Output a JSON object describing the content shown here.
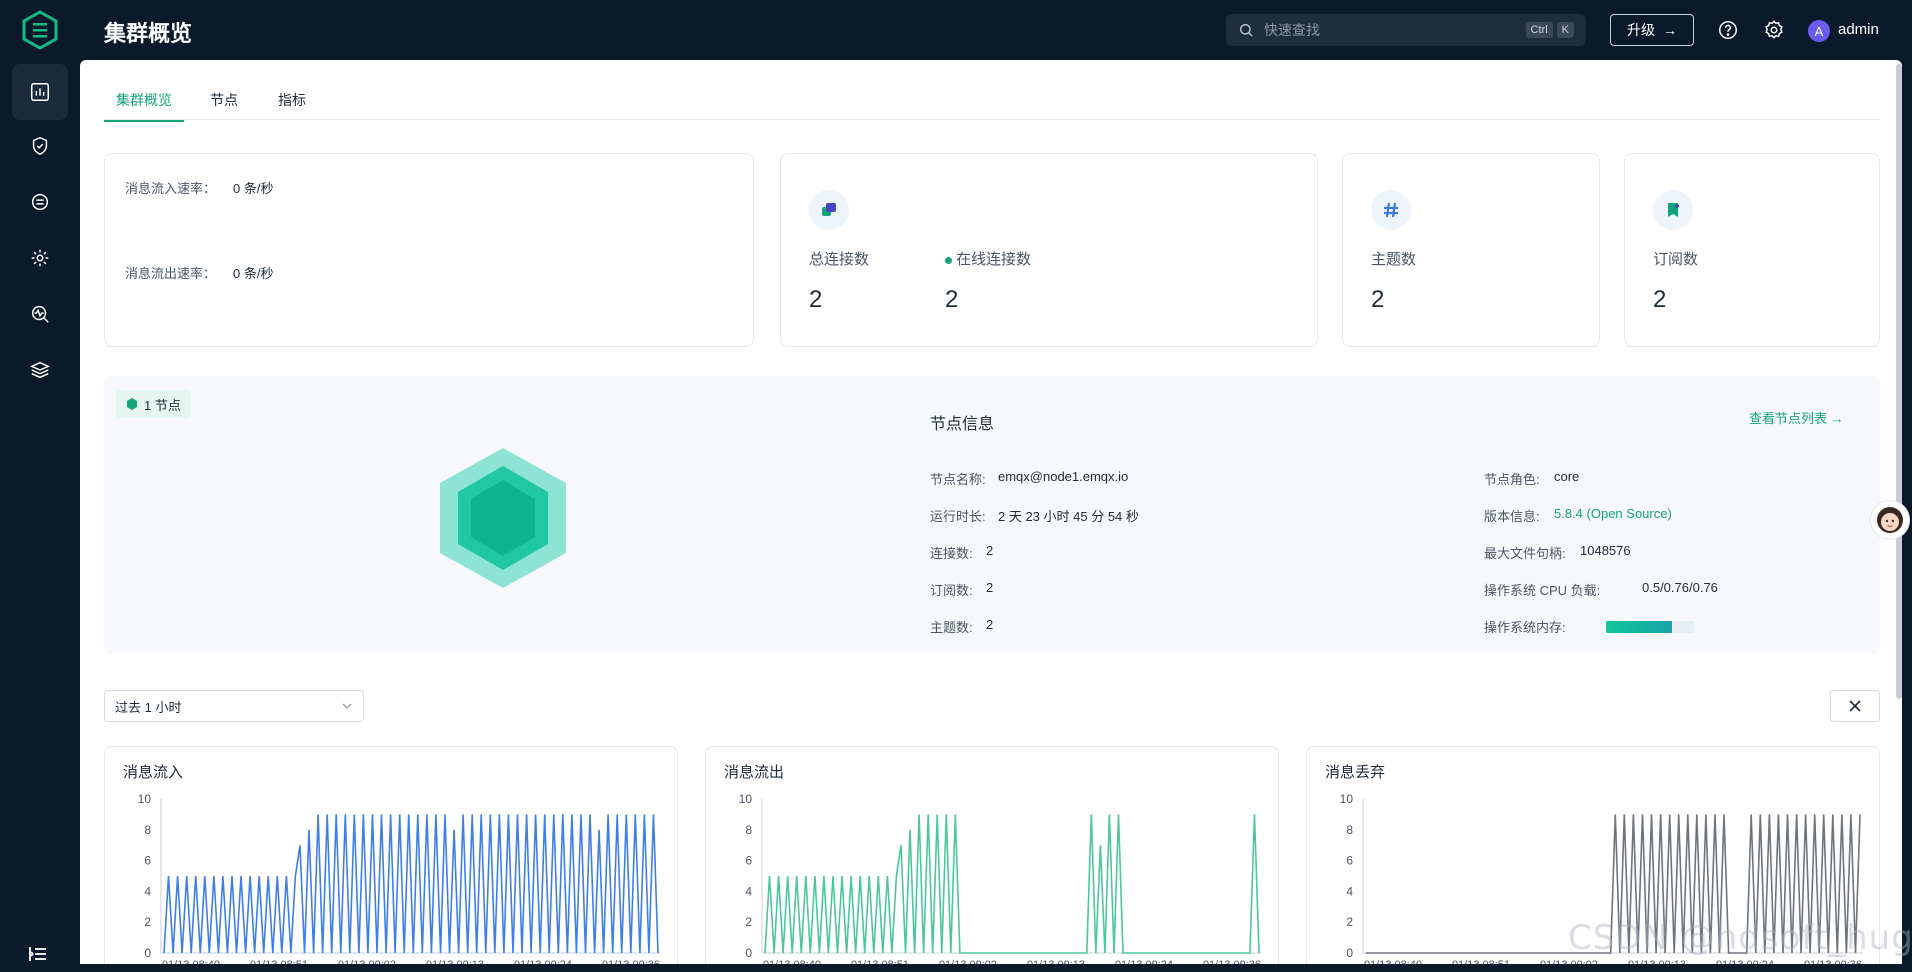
{
  "header": {
    "title": "集群概览",
    "search_placeholder": "快速查找",
    "search_kbd": [
      "Ctrl",
      "K"
    ],
    "upgrade_label": "升级",
    "user_initial": "A",
    "username": "admin"
  },
  "sidebar": {
    "items": [
      {
        "name": "dashboard-icon",
        "active": true
      },
      {
        "name": "shield-icon",
        "active": false
      },
      {
        "name": "integration-icon",
        "active": false
      },
      {
        "name": "settings-gear-icon",
        "active": false
      },
      {
        "name": "monitor-icon",
        "active": false
      },
      {
        "name": "layers-icon",
        "active": false
      }
    ]
  },
  "tabs": [
    "集群概览",
    "节点",
    "指标"
  ],
  "rates": {
    "in_label": "消息流入速率：",
    "in_value": "0 条/秒",
    "out_label": "消息流出速率：",
    "out_value": "0 条/秒"
  },
  "stats": {
    "total_conn_label": "总连接数",
    "total_conn_value": "2",
    "online_conn_label": "在线连接数",
    "online_conn_value": "2",
    "topics_label": "主题数",
    "topics_value": "2",
    "subs_label": "订阅数",
    "subs_value": "2"
  },
  "node": {
    "badge": "1 节点",
    "info_title": "节点信息",
    "list_link": "查看节点列表",
    "left": [
      {
        "label": "节点名称:",
        "value": "emqx@node1.emqx.io"
      },
      {
        "label": "运行时长:",
        "value": "2 天 23 小时 45 分 54 秒"
      },
      {
        "label": "连接数:",
        "value": "2"
      },
      {
        "label": "订阅数:",
        "value": "2"
      },
      {
        "label": "主题数:",
        "value": "2"
      }
    ],
    "right": [
      {
        "label": "节点角色:",
        "value": "core"
      },
      {
        "label": "版本信息:",
        "value": "5.8.4 (Open Source)"
      },
      {
        "label": "最大文件句柄:",
        "value": "1048576"
      },
      {
        "label": "操作系统 CPU 负载:",
        "value": "0.5/0.76/0.76"
      },
      {
        "label": "操作系统内存:",
        "value": ""
      }
    ],
    "memory_fraction": 0.75
  },
  "time_range": "过去 1 小时",
  "colors": {
    "accent": "#15a37b",
    "in": "#3f7ee8",
    "out": "#4cc79a",
    "drop": "#6e737c"
  },
  "chart_data": [
    {
      "type": "line",
      "title": "消息流入",
      "ylim": [
        0,
        10
      ],
      "yticks": [
        0,
        2,
        4,
        6,
        8,
        10
      ],
      "xticks": [
        "01/13 08:40",
        "01/13 08:51",
        "01/13 09:02",
        "01/13 09:13",
        "01/13 09:24",
        "01/13 09:36"
      ],
      "series": [
        {
          "values": [
            0,
            5,
            0,
            5,
            0,
            5,
            0,
            5,
            0,
            5,
            0,
            5,
            0,
            5,
            0,
            5,
            0,
            5,
            0,
            5,
            0,
            5,
            0,
            5,
            0,
            5,
            0,
            5,
            0,
            5,
            7,
            0,
            8,
            0,
            9,
            0,
            9,
            0,
            9,
            0,
            9,
            0,
            9,
            0,
            9,
            0,
            9,
            0,
            9,
            0,
            9,
            0,
            9,
            0,
            9,
            0,
            9,
            0,
            9,
            0,
            9,
            0,
            9,
            0,
            8,
            0,
            9,
            0,
            9,
            0,
            9,
            0,
            9,
            0,
            9,
            0,
            9,
            0,
            9,
            0,
            9,
            0,
            9,
            0,
            9,
            0,
            9,
            0,
            9,
            0,
            9,
            0,
            9,
            0,
            9,
            0,
            8,
            0,
            9,
            0,
            9,
            0,
            9,
            0,
            9,
            0,
            9,
            0,
            9,
            0
          ]
        }
      ]
    },
    {
      "type": "line",
      "title": "消息流出",
      "ylim": [
        0,
        10
      ],
      "yticks": [
        0,
        2,
        4,
        6,
        8,
        10
      ],
      "xticks": [
        "01/13 08:40",
        "01/13 08:51",
        "01/13 09:02",
        "01/13 09:13",
        "01/13 09:24",
        "01/13 09:36"
      ],
      "series": [
        {
          "values": [
            0,
            5,
            0,
            5,
            0,
            5,
            0,
            5,
            0,
            5,
            0,
            5,
            0,
            5,
            0,
            5,
            0,
            5,
            0,
            5,
            0,
            5,
            0,
            5,
            0,
            5,
            0,
            5,
            0,
            5,
            7,
            0,
            8,
            0,
            9,
            0,
            9,
            0,
            9,
            0,
            9,
            0,
            9,
            0,
            0,
            0,
            0,
            0,
            0,
            0,
            0,
            0,
            0,
            0,
            0,
            0,
            0,
            0,
            0,
            0,
            0,
            0,
            0,
            0,
            0,
            0,
            0,
            0,
            0,
            0,
            0,
            0,
            9,
            0,
            7,
            0,
            9,
            0,
            9,
            0,
            0,
            0,
            0,
            0,
            0,
            0,
            0,
            0,
            0,
            0,
            0,
            0,
            0,
            0,
            0,
            0,
            0,
            0,
            0,
            0,
            0,
            0,
            0,
            0,
            0,
            0,
            0,
            0,
            9,
            0
          ]
        }
      ]
    },
    {
      "type": "line",
      "title": "消息丢弃",
      "ylim": [
        0,
        10
      ],
      "yticks": [
        0,
        2,
        4,
        6,
        8,
        10
      ],
      "xticks": [
        "01/13 08:40",
        "01/13 08:51",
        "01/13 09:02",
        "01/13 09:13",
        "01/13 09:24",
        "01/13 09:36"
      ],
      "series": [
        {
          "values": [
            0,
            0,
            0,
            0,
            0,
            0,
            0,
            0,
            0,
            0,
            0,
            0,
            0,
            0,
            0,
            0,
            0,
            0,
            0,
            0,
            0,
            0,
            0,
            0,
            0,
            0,
            0,
            0,
            0,
            0,
            0,
            0,
            0,
            0,
            0,
            0,
            0,
            0,
            0,
            0,
            0,
            0,
            0,
            0,
            0,
            0,
            0,
            0,
            0,
            0,
            0,
            0,
            0,
            0,
            0,
            9,
            0,
            9,
            0,
            9,
            0,
            9,
            0,
            9,
            0,
            9,
            0,
            9,
            0,
            9,
            0,
            9,
            0,
            9,
            0,
            9,
            0,
            9,
            0,
            9,
            0,
            0,
            0,
            0,
            0,
            9,
            0,
            9,
            0,
            9,
            0,
            9,
            0,
            9,
            0,
            9,
            0,
            9,
            0,
            9,
            0,
            9,
            0,
            9,
            0,
            9,
            0,
            9,
            0,
            9
          ]
        }
      ]
    }
  ],
  "watermark": "CSDN @hdsoft_huge"
}
